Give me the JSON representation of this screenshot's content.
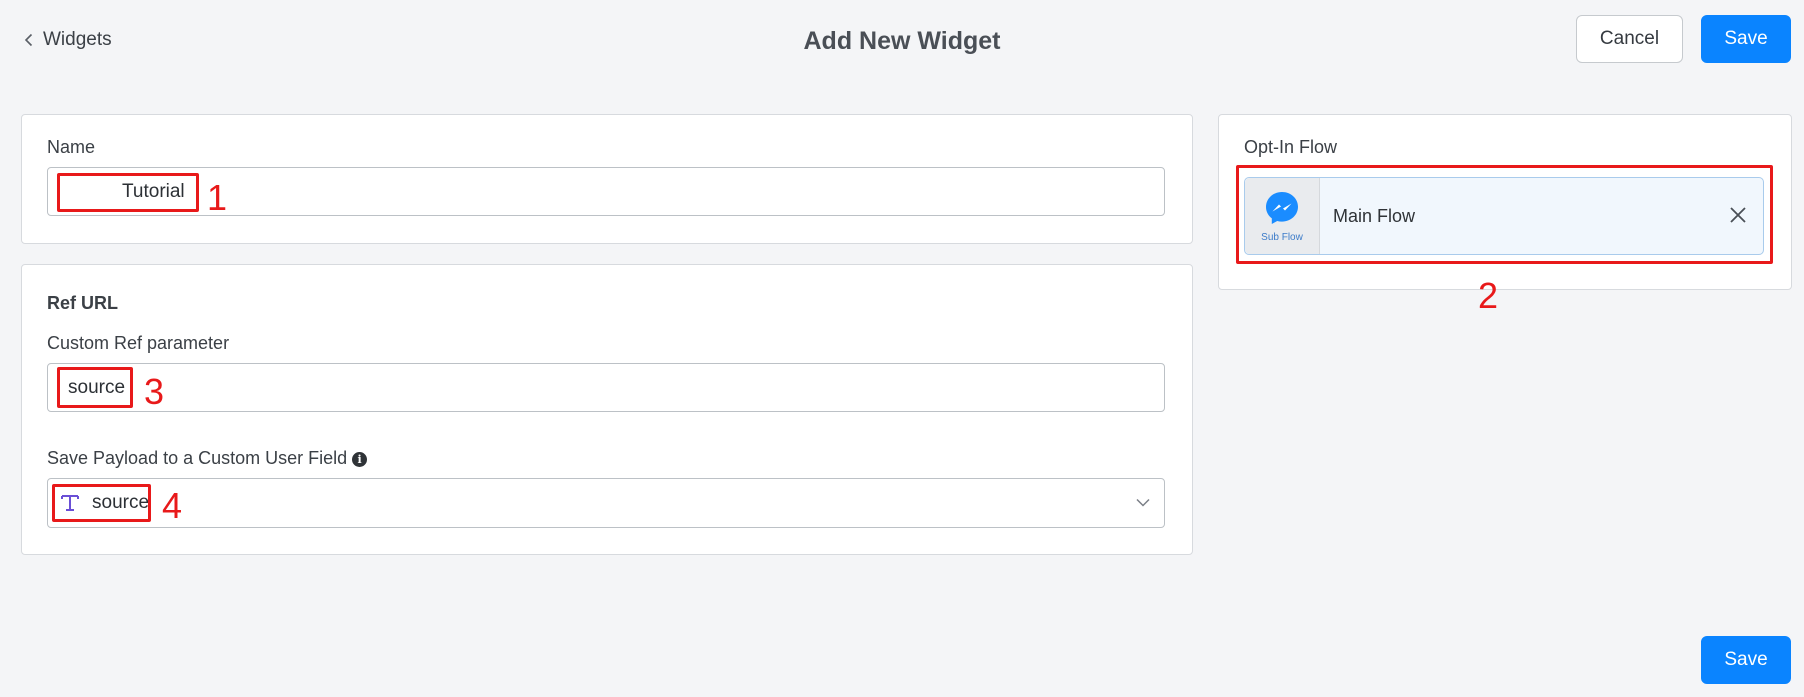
{
  "header": {
    "back_label": "Widgets",
    "title": "Add New Widget",
    "cancel_label": "Cancel",
    "save_label": "Save"
  },
  "name_section": {
    "label": "Name",
    "value": "Tutorial"
  },
  "ref_section": {
    "title": "Ref URL",
    "param_label": "Custom Ref parameter",
    "param_value": "source",
    "payload_label": "Save Payload to a Custom User Field",
    "payload_value": "source",
    "payload_type_icon": "text-field-icon"
  },
  "optin_section": {
    "label": "Opt-In Flow",
    "flow_icon": "messenger-icon",
    "flow_type": "Sub Flow",
    "flow_name": "Main Flow"
  },
  "footer": {
    "save_label": "Save"
  },
  "annotations": [
    "1",
    "2",
    "3",
    "4"
  ],
  "colors": {
    "primary": "#0a84ff",
    "annotation": "#e8191a",
    "background": "#f4f5f7"
  }
}
